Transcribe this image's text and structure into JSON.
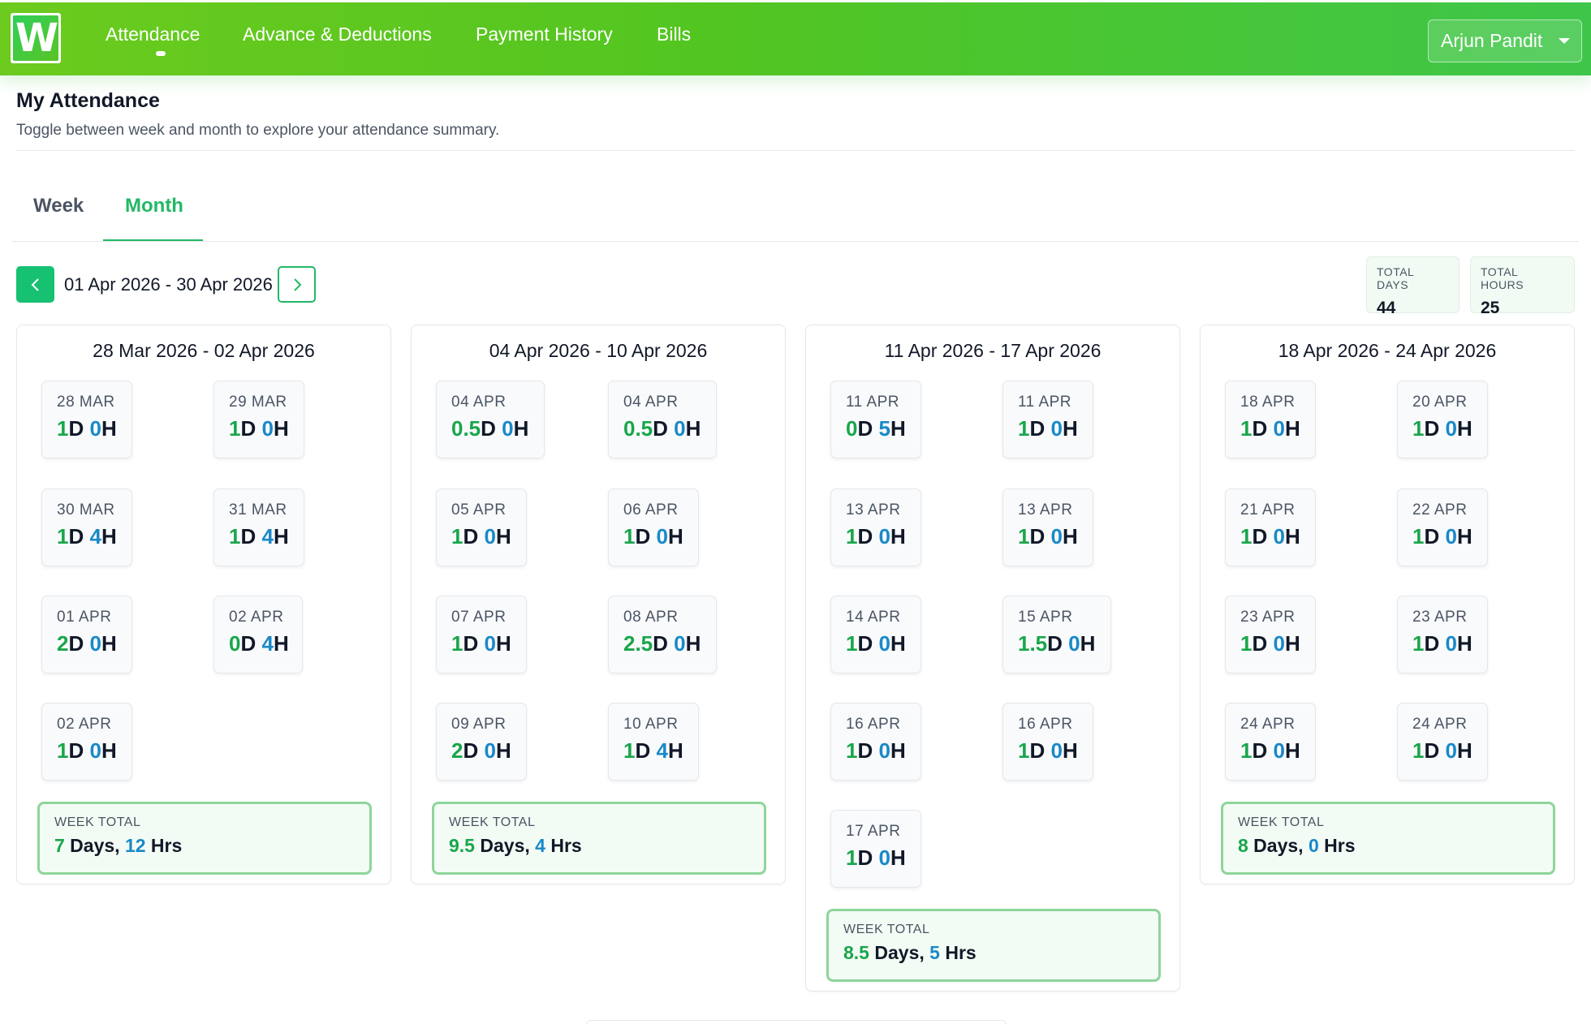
{
  "nav": {
    "logo_letter": "W",
    "items": [
      "Attendance",
      "Advance & Deductions",
      "Payment History",
      "Bills"
    ],
    "user_name": "Arjun Pandit"
  },
  "header": {
    "title": "My Attendance",
    "subtitle": "Toggle between week and month to explore your attendance summary."
  },
  "tabs": [
    "Week",
    "Month"
  ],
  "range": "01 Apr 2026 - 30 Apr 2026",
  "totals": {
    "days_label": "TOTAL DAYS",
    "days_value": "44",
    "hours_label": "TOTAL HOURS",
    "hours_value": "25"
  },
  "week_total_label": "WEEK TOTAL",
  "weeks": [
    {
      "title": "28 Mar 2026 - 02 Apr 2026",
      "days": [
        {
          "date": "28 MAR",
          "d": "1",
          "h": "0"
        },
        {
          "date": "29 MAR",
          "d": "1",
          "h": "0"
        },
        {
          "date": "30 MAR",
          "d": "1",
          "h": "4"
        },
        {
          "date": "31 MAR",
          "d": "1",
          "h": "4"
        },
        {
          "date": "01 APR",
          "d": "2",
          "h": "0"
        },
        {
          "date": "02 APR",
          "d": "0",
          "h": "4"
        },
        {
          "date": "02 APR",
          "d": "1",
          "h": "0"
        }
      ],
      "total_days": "7",
      "total_hrs": "12"
    },
    {
      "title": "04 Apr 2026 - 10 Apr 2026",
      "days": [
        {
          "date": "04 APR",
          "d": "0.5",
          "h": "0"
        },
        {
          "date": "04 APR",
          "d": "0.5",
          "h": "0"
        },
        {
          "date": "05 APR",
          "d": "1",
          "h": "0"
        },
        {
          "date": "06 APR",
          "d": "1",
          "h": "0"
        },
        {
          "date": "07 APR",
          "d": "1",
          "h": "0"
        },
        {
          "date": "08 APR",
          "d": "2.5",
          "h": "0"
        },
        {
          "date": "09 APR",
          "d": "2",
          "h": "0"
        },
        {
          "date": "10 APR",
          "d": "1",
          "h": "4"
        }
      ],
      "total_days": "9.5",
      "total_hrs": "4"
    },
    {
      "title": "11 Apr 2026 - 17 Apr 2026",
      "days": [
        {
          "date": "11 APR",
          "d": "0",
          "h": "5"
        },
        {
          "date": "11 APR",
          "d": "1",
          "h": "0"
        },
        {
          "date": "13 APR",
          "d": "1",
          "h": "0"
        },
        {
          "date": "13 APR",
          "d": "1",
          "h": "0"
        },
        {
          "date": "14 APR",
          "d": "1",
          "h": "0"
        },
        {
          "date": "15 APR",
          "d": "1.5",
          "h": "0"
        },
        {
          "date": "16 APR",
          "d": "1",
          "h": "0"
        },
        {
          "date": "16 APR",
          "d": "1",
          "h": "0"
        },
        {
          "date": "17 APR",
          "d": "1",
          "h": "0"
        }
      ],
      "total_days": "8.5",
      "total_hrs": "5"
    },
    {
      "title": "18 Apr 2026 - 24 Apr 2026",
      "days": [
        {
          "date": "18 APR",
          "d": "1",
          "h": "0"
        },
        {
          "date": "20 APR",
          "d": "1",
          "h": "0"
        },
        {
          "date": "21 APR",
          "d": "1",
          "h": "0"
        },
        {
          "date": "22 APR",
          "d": "1",
          "h": "0"
        },
        {
          "date": "23 APR",
          "d": "1",
          "h": "0"
        },
        {
          "date": "23 APR",
          "d": "1",
          "h": "0"
        },
        {
          "date": "24 APR",
          "d": "1",
          "h": "0"
        },
        {
          "date": "24 APR",
          "d": "1",
          "h": "0"
        }
      ],
      "total_days": "8",
      "total_hrs": "0"
    }
  ],
  "colors": {
    "accent_green": "#22b866",
    "days_green": "#18a64a",
    "hours_blue": "#1989c8"
  }
}
